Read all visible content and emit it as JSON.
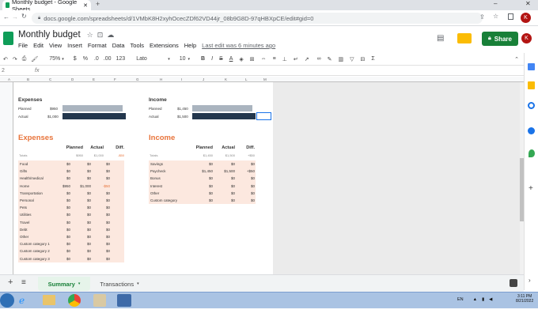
{
  "browser": {
    "tab_title": "Monthly budget - Google Sheets",
    "url": "docs.google.com/spreadsheets/d/1VMbK8H2xyhOcecZDf62VD44jr_08b9G8D-97qHBXpCE/edit#gid=0"
  },
  "doc": {
    "title": "Monthly budget",
    "menu": [
      "File",
      "Edit",
      "View",
      "Insert",
      "Format",
      "Data",
      "Tools",
      "Extensions",
      "Help"
    ],
    "last_edit": "Last edit was 6 minutes ago",
    "share_label": "Share",
    "avatar_letter": "K"
  },
  "toolbar": {
    "zoom": "75%",
    "currency": "$",
    "percent": "%",
    "dec_less": ".0",
    "dec_more": ".00",
    "format_num": "123",
    "font": "Lato",
    "font_size": "10",
    "bold": "B",
    "italic": "I",
    "strike": "S",
    "text_color": "A"
  },
  "formula": {
    "cell_ref": "2",
    "fx": "fx",
    "value": ""
  },
  "columns": [
    "A",
    "B",
    "C",
    "D",
    "E",
    "F",
    "G",
    "H",
    "I",
    "J",
    "K",
    "L",
    "M"
  ],
  "summary": {
    "expenses": {
      "title": "Expenses",
      "planned_label": "Planned",
      "planned": "$950",
      "actual_label": "Actual",
      "actual": "$1,000"
    },
    "income": {
      "title": "Income",
      "planned_label": "Planned",
      "planned": "$1,450",
      "actual_label": "Actual",
      "actual": "$1,500"
    }
  },
  "expenses_table": {
    "title": "Expenses",
    "headers": [
      "Planned",
      "Actual",
      "Diff."
    ],
    "totals_label": "Totals",
    "totals": [
      "$950",
      "$1,000",
      "-$50"
    ],
    "rows": [
      [
        "Food",
        "$0",
        "$0",
        "$0"
      ],
      [
        "Gifts",
        "$0",
        "$0",
        "$0"
      ],
      [
        "Health/medical",
        "$0",
        "$0",
        "$0"
      ],
      [
        "Home",
        "$950",
        "$1,000",
        "-$50"
      ],
      [
        "Transportation",
        "$0",
        "$0",
        "$0"
      ],
      [
        "Personal",
        "$0",
        "$0",
        "$0"
      ],
      [
        "Pets",
        "$0",
        "$0",
        "$0"
      ],
      [
        "Utilities",
        "$0",
        "$0",
        "$0"
      ],
      [
        "Travel",
        "$0",
        "$0",
        "$0"
      ],
      [
        "Debt",
        "$0",
        "$0",
        "$0"
      ],
      [
        "Other",
        "$0",
        "$0",
        "$0"
      ],
      [
        "Custom category 1",
        "$0",
        "$0",
        "$0"
      ],
      [
        "Custom category 2",
        "$0",
        "$0",
        "$0"
      ],
      [
        "Custom category 3",
        "$0",
        "$0",
        "$0"
      ]
    ]
  },
  "income_table": {
    "title": "Income",
    "headers": [
      "Planned",
      "Actual",
      "Diff."
    ],
    "totals_label": "Totals",
    "totals": [
      "$1,450",
      "$1,500",
      "+$50"
    ],
    "rows": [
      [
        "Savings",
        "$0",
        "$0",
        "$0"
      ],
      [
        "Paycheck",
        "$1,450",
        "$1,500",
        "+$50"
      ],
      [
        "Bonus",
        "$0",
        "$0",
        "$0"
      ],
      [
        "Interest",
        "$0",
        "$0",
        "$0"
      ],
      [
        "Other",
        "$0",
        "$0",
        "$0"
      ],
      [
        "Custom category",
        "$0",
        "$0",
        "$0"
      ]
    ]
  },
  "sheet_tabs": {
    "add": "+",
    "list": "≡",
    "summary": "Summary",
    "transactions": "Transactions"
  },
  "taskbar": {
    "lang": "EN",
    "time": "3:11 PM",
    "date": "8/21/2022"
  },
  "colors": {
    "accent_orange": "#e8743b",
    "bar_planned": "#aab4bf",
    "bar_actual": "#23374d",
    "share_green": "#188038",
    "row_fill": "#fce8df"
  }
}
